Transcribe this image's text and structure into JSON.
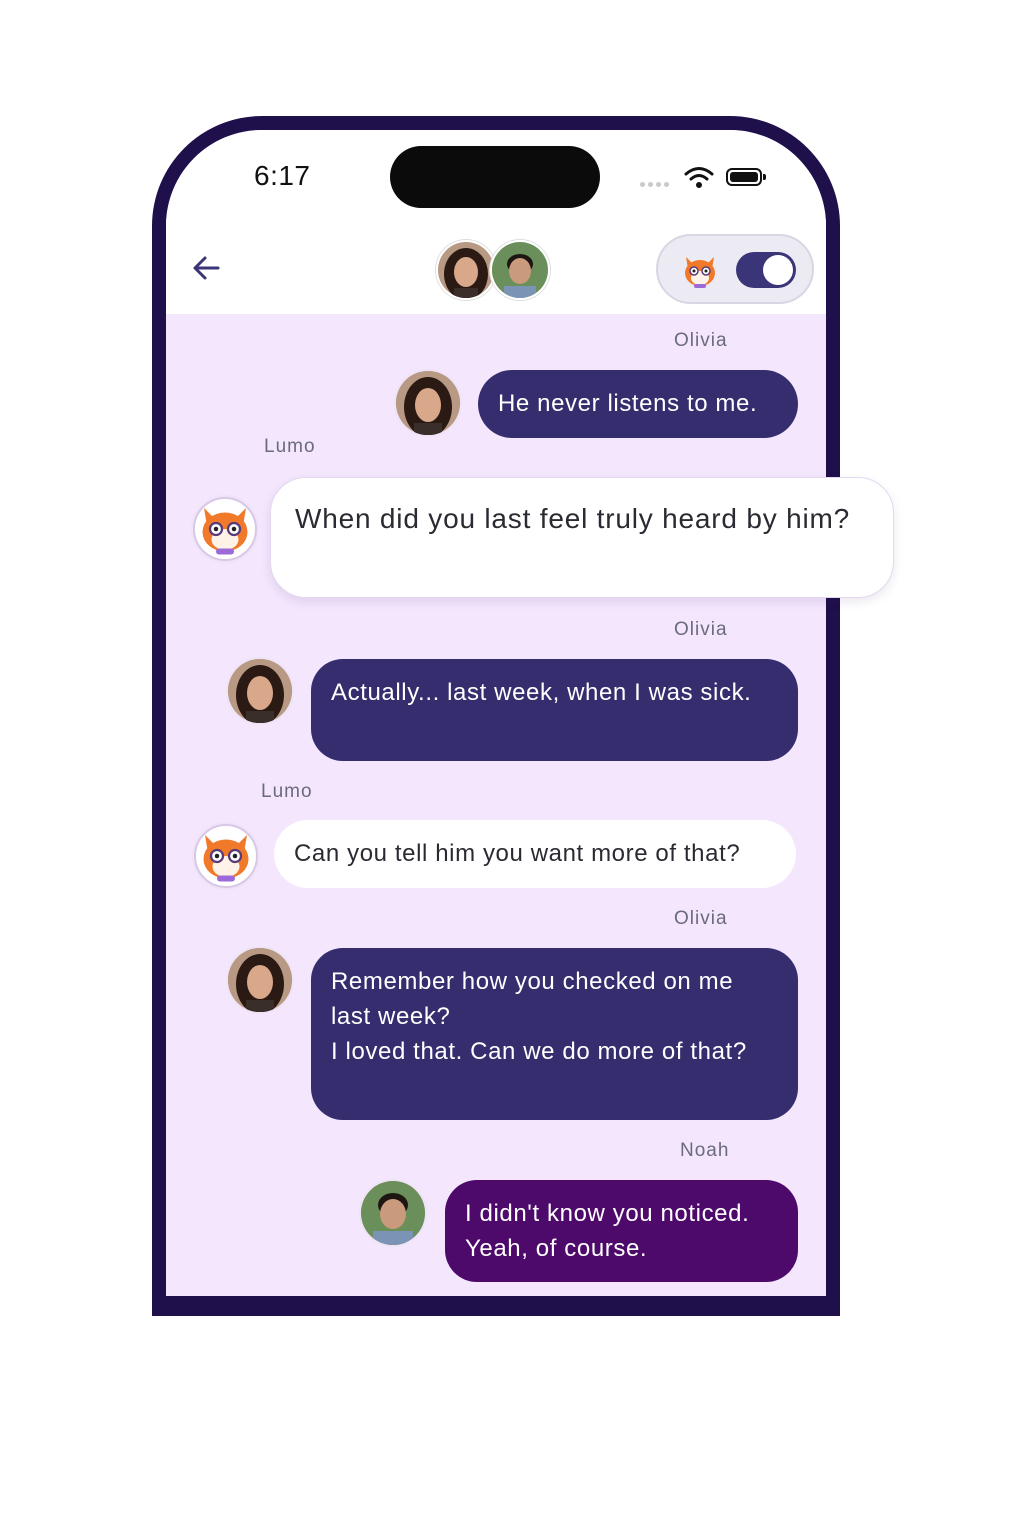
{
  "status_bar": {
    "time": "6:17"
  },
  "header": {
    "back_icon": "arrow-left-icon",
    "participants": [
      "Olivia",
      "Noah"
    ],
    "lumo_mode": {
      "icon": "fox-mascot-icon",
      "enabled": true
    }
  },
  "messages": [
    {
      "sender": "Olivia",
      "text": "He never listens to me.",
      "style": "dark"
    },
    {
      "sender": "Lumo",
      "text": "When did you last feel truly heard by him?",
      "style": "light-highlight"
    },
    {
      "sender": "Olivia",
      "text": "Actually... last week, when I was sick.",
      "style": "dark"
    },
    {
      "sender": "Lumo",
      "text": "Can you tell him you want more of that?",
      "style": "light"
    },
    {
      "sender": "Olivia",
      "text_lines": [
        "Remember how you checked on me last week?",
        "I loved that. Can we do more of that?"
      ],
      "style": "dark"
    },
    {
      "sender": "Noah",
      "text_lines": [
        "I didn't know you noticed.",
        "Yeah, of course."
      ],
      "style": "purple"
    }
  ],
  "colors": {
    "frame": "#1f0f4a",
    "chat_background": "#f3e6fd",
    "olivia_bubble": "#352d6e",
    "noah_bubble": "#4e0a6b",
    "lumo_bubble": "#ffffff"
  }
}
